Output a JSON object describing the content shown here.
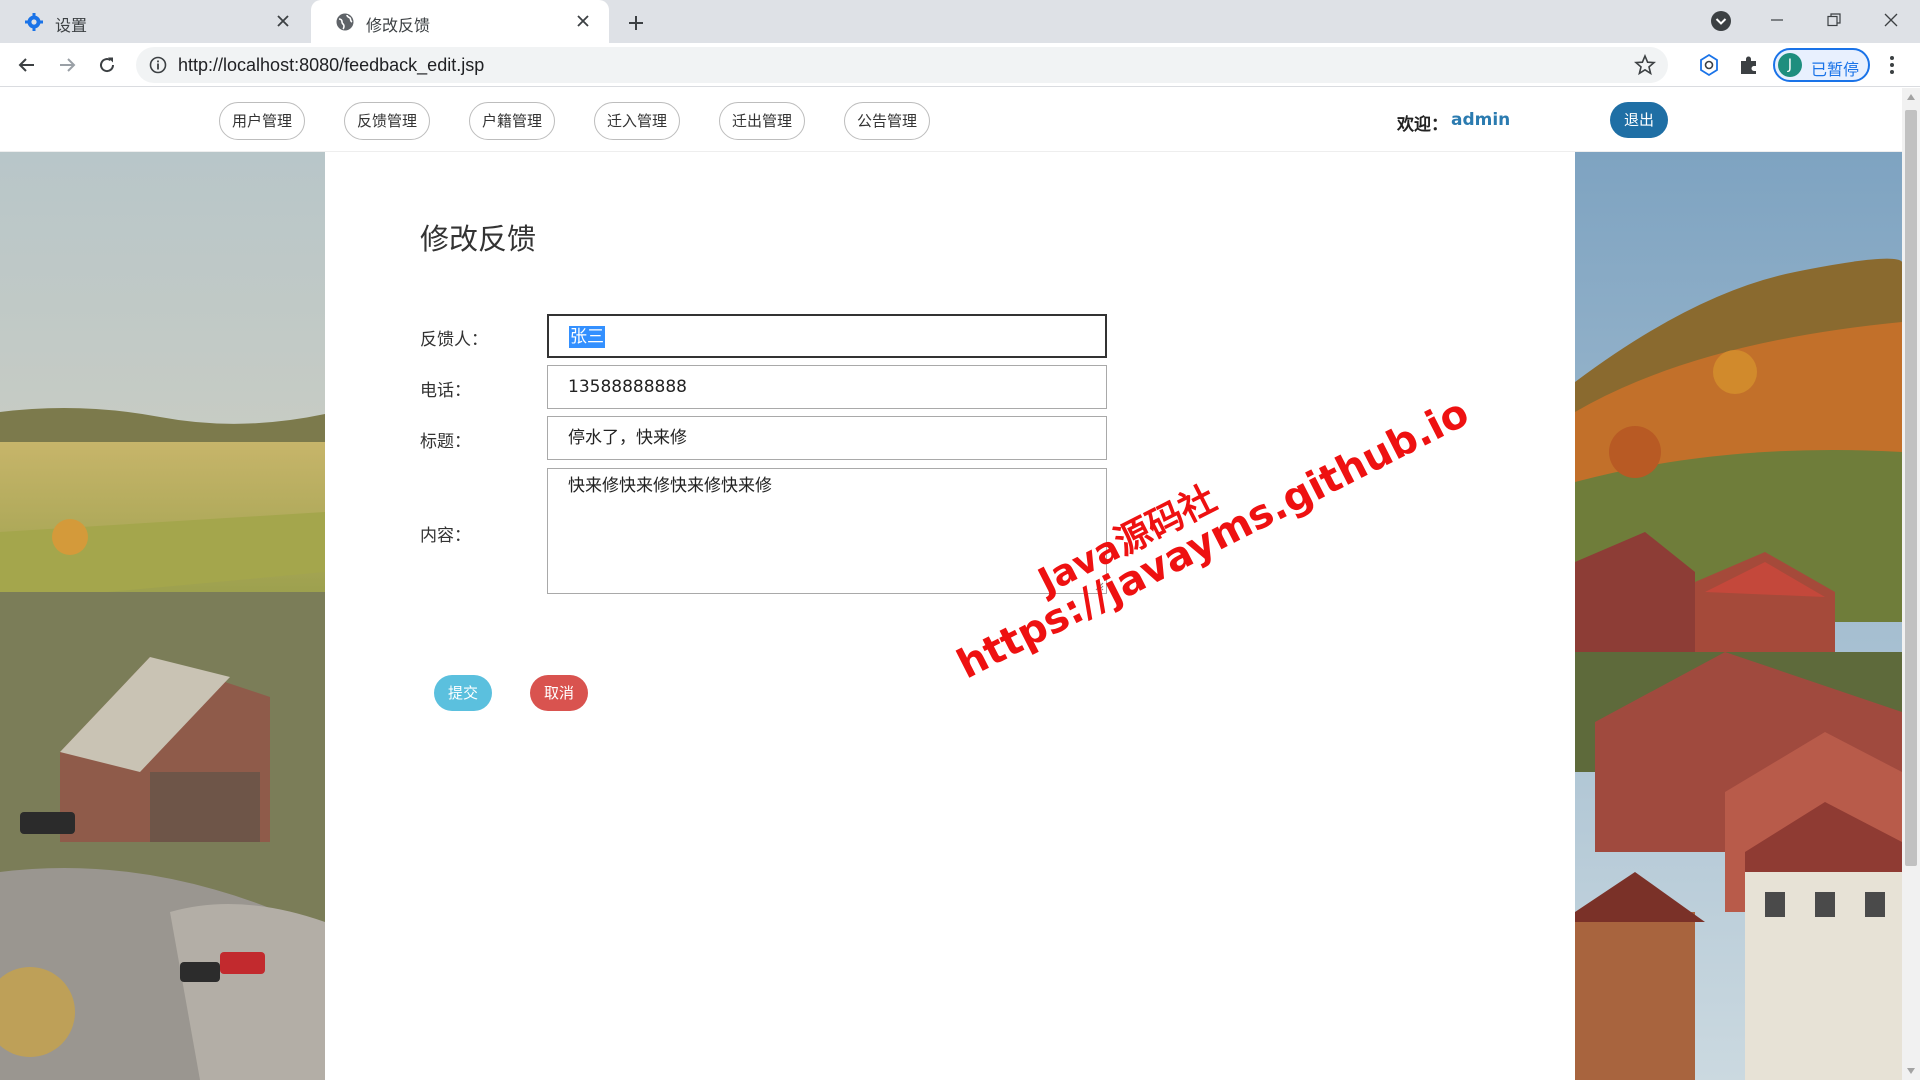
{
  "browser": {
    "tabs": [
      {
        "title": "设置",
        "icon": "gear-icon",
        "active": false
      },
      {
        "title": "修改反馈",
        "icon": "globe-icon",
        "active": true
      }
    ],
    "url": "http://localhost:8080/feedback_edit.jsp",
    "profile_initial": "J",
    "profile_status": "已暂停",
    "accent_color": "#1a73e8"
  },
  "nav": {
    "items": [
      "用户管理",
      "反馈管理",
      "户籍管理",
      "迁入管理",
      "迁出管理",
      "公告管理"
    ],
    "welcome_label": "欢迎：",
    "username": "admin",
    "logout": "退出"
  },
  "form": {
    "title": "修改反馈",
    "fields": {
      "name": {
        "label": "反馈人：",
        "value": "张三"
      },
      "phone": {
        "label": "电话：",
        "value": "13588888888"
      },
      "subject": {
        "label": "标题：",
        "value": "停水了，快来修"
      },
      "content": {
        "label": "内容：",
        "value": "快来修快来修快来修快来修"
      }
    },
    "submit": "提交",
    "cancel": "取消"
  },
  "watermark": {
    "line1": "Java源码社",
    "line2": "https://javayms.github.io"
  },
  "colors": {
    "submit": "#5bc0de",
    "cancel": "#d9534f",
    "logout": "#1f6fa5",
    "username": "#2b7bb0",
    "watermark": "#ee1111"
  }
}
